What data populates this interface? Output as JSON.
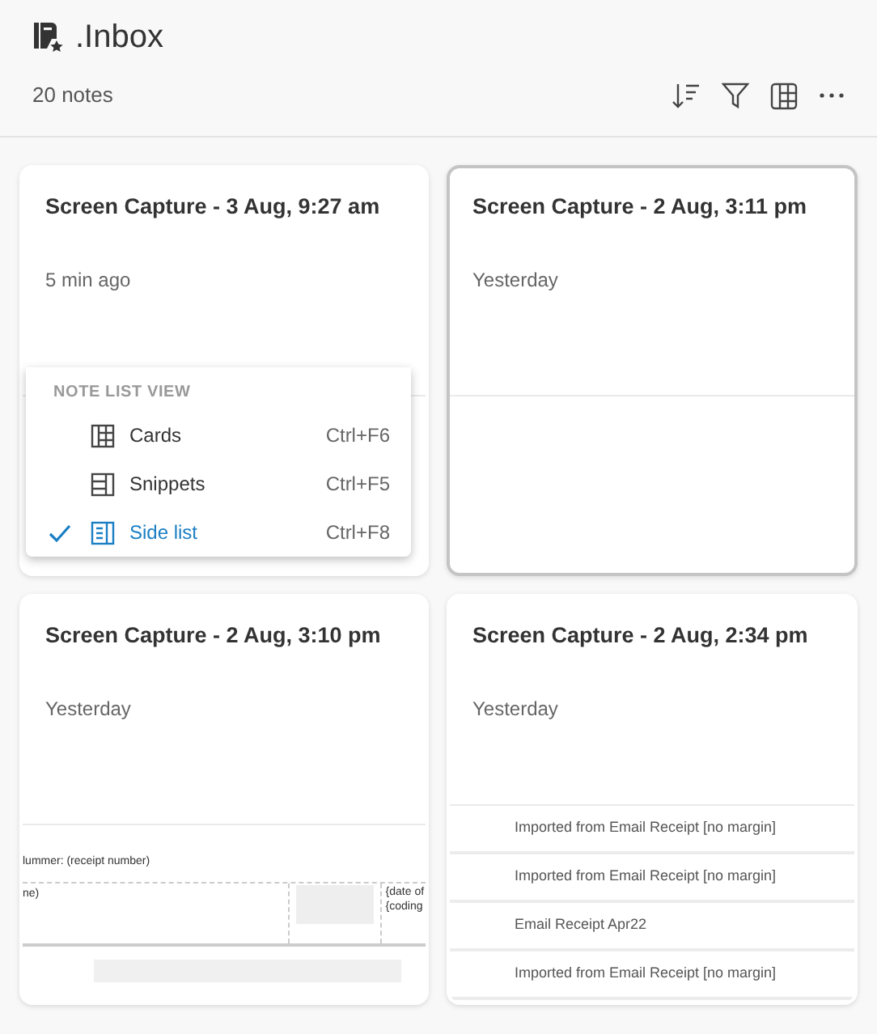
{
  "header": {
    "title": ".Inbox",
    "count": "20 notes"
  },
  "notes": [
    {
      "title": "Screen Capture - 3 Aug, 9:27 am",
      "time": "5 min ago",
      "selected": false,
      "preview": {
        "kind": "blank"
      }
    },
    {
      "title": "Screen Capture - 2 Aug, 3:11 pm",
      "time": "Yesterday",
      "selected": true,
      "preview": {
        "kind": "blank"
      }
    },
    {
      "title": "Screen Capture - 2 Aug, 3:10 pm",
      "time": "Yesterday",
      "selected": false,
      "preview": {
        "kind": "document",
        "heading": "lummer: (receipt number)",
        "cells": [
          "ne)",
          "{date of",
          "{coding"
        ]
      }
    },
    {
      "title": "Screen Capture - 2 Aug, 2:34 pm",
      "time": "Yesterday",
      "selected": false,
      "preview": {
        "kind": "rows",
        "rows": [
          "Imported from Email Receipt [no margin]",
          "Imported from Email Receipt [no margin]",
          "Email Receipt Apr22",
          "Imported from Email Receipt [no margin]"
        ]
      }
    }
  ],
  "view_menu": {
    "heading": "NOTE LIST VIEW",
    "items": [
      {
        "kind": "cards",
        "label": "Cards",
        "shortcut": "Ctrl+F6",
        "selected": false
      },
      {
        "kind": "snippets",
        "label": "Snippets",
        "shortcut": "Ctrl+F5",
        "selected": false
      },
      {
        "kind": "side",
        "label": "Side list",
        "shortcut": "Ctrl+F8",
        "selected": true
      }
    ]
  }
}
